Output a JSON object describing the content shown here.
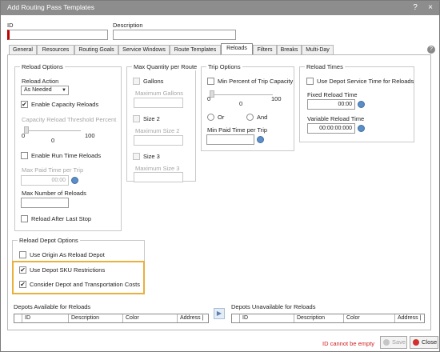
{
  "window": {
    "title": "Add Routing Pass Templates",
    "help": "?",
    "close": "×"
  },
  "header": {
    "id_label": "ID",
    "description_label": "Description",
    "id_value": "",
    "description_value": ""
  },
  "tabs": [
    "General",
    "Resources",
    "Routing Goals",
    "Service Windows",
    "Route Templates",
    "Reloads",
    "Filters",
    "Breaks",
    "Multi-Day"
  ],
  "active_tab": "Reloads",
  "reload_options": {
    "title": "Reload Options",
    "action_label": "Reload Action",
    "action_value": "As Needed",
    "enable_capacity": "Enable Capacity Reloads",
    "capacity_threshold": "Capacity Reload Threshold Percent",
    "slider_min": "0",
    "slider_max": "100",
    "slider_value": "0",
    "enable_runtime": "Enable Run Time Reloads",
    "max_paid_time": "Max Paid Time per Trip",
    "max_paid_time_value": "00:00",
    "max_reloads": "Max Number of Reloads",
    "reload_after_last": "Reload After Last Stop"
  },
  "max_quantity": {
    "title": "Max Quantity per Route",
    "gallons": "Gallons",
    "max_gallons": "Maximum Gallons",
    "size2": "Size 2",
    "max_size2": "Maximum Size 2",
    "size3": "Size 3",
    "max_size3": "Maximum Size 3"
  },
  "trip_options": {
    "title": "Trip Options",
    "min_percent": "Min Percent of Trip Capacity",
    "slider_min": "0",
    "slider_max": "100",
    "slider_value": "0",
    "or": "Or",
    "and": "And",
    "min_paid_time": "Min Paid Time per Trip"
  },
  "reload_times": {
    "title": "Reload Times",
    "use_depot": "Use Depot Service Time for Reloads",
    "fixed_label": "Fixed Reload Time",
    "fixed_value": "00:00",
    "variable_label": "Variable Reload Time",
    "variable_value": "00:00:00:000"
  },
  "reload_depot": {
    "title": "Reload Depot Options",
    "use_origin": "Use Origin As Reload Depot",
    "use_sku": "Use Depot SKU Restrictions",
    "consider_costs": "Consider Depot and Transportation Costs"
  },
  "depots_available": {
    "title": "Depots Available for Reloads",
    "columns": [
      "ID",
      "Description",
      "Color",
      "Address |"
    ]
  },
  "depots_unavailable": {
    "title": "Depots Unavailable for Reloads",
    "columns": [
      "ID",
      "Description",
      "Color",
      "Address |"
    ]
  },
  "mover_icon": "▶",
  "footer": {
    "error": "ID cannot be empty",
    "save": "Save",
    "close": "Close"
  },
  "colors": {
    "titlebar": "#8d8d8d",
    "highlight": "#e9b03c",
    "error": "#d02020"
  }
}
